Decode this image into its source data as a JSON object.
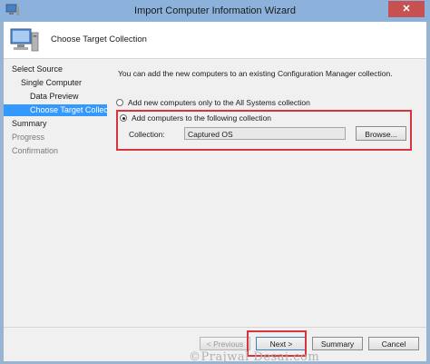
{
  "window": {
    "title": "Import Computer Information Wizard",
    "close_glyph": "✕"
  },
  "header": {
    "title": "Choose Target Collection"
  },
  "nav": {
    "items": [
      {
        "label": "Select Source",
        "indent": 0,
        "state": "normal"
      },
      {
        "label": "Single Computer",
        "indent": 1,
        "state": "normal"
      },
      {
        "label": "Data Preview",
        "indent": 2,
        "state": "normal"
      },
      {
        "label": "Choose Target Collect",
        "indent": 2,
        "state": "active"
      },
      {
        "label": "Summary",
        "indent": 0,
        "state": "normal"
      },
      {
        "label": "Progress",
        "indent": 0,
        "state": "muted"
      },
      {
        "label": "Confirmation",
        "indent": 0,
        "state": "muted"
      }
    ]
  },
  "content": {
    "intro": "You can add the new computers to an existing Configuration Manager collection.",
    "option_all_systems": "Add new computers only to the All Systems collection",
    "option_following": "Add computers to the following collection",
    "collection_label": "Collection:",
    "collection_value": "Captured OS",
    "browse_label": "Browse..."
  },
  "footer": {
    "previous_label": "< Previous",
    "next_label": "Next >",
    "summary_label": "Summary",
    "cancel_label": "Cancel"
  },
  "watermark": "©Prajwal Desai.com",
  "colors": {
    "accent": "#3399ff",
    "highlight": "#d9343b",
    "titlebar": "#8cb1da",
    "close": "#c75050"
  }
}
